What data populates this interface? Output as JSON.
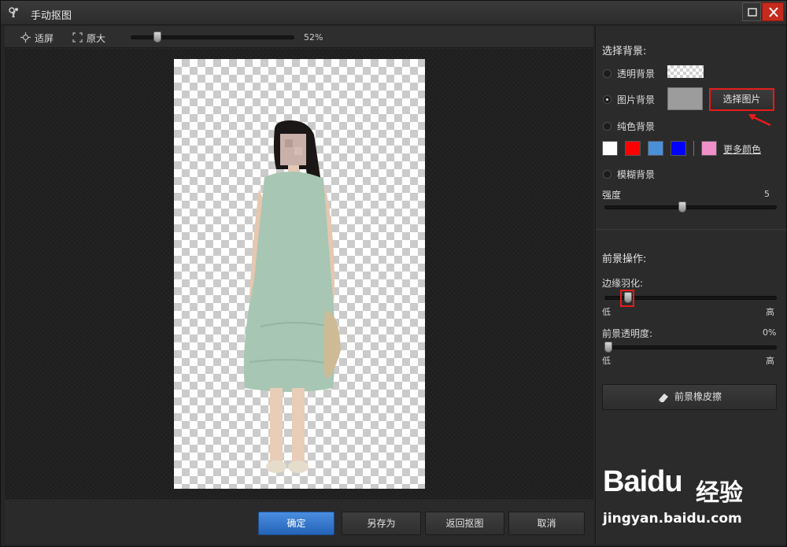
{
  "window": {
    "title": "手动抠图",
    "controls": {
      "maximize_icon": "maximize-icon",
      "close_icon": "close-icon"
    }
  },
  "toolbar": {
    "fit_screen_label": "适屏",
    "original_size_label": "原大",
    "zoom_value": "52%",
    "zoom_percent": 52
  },
  "footer": {
    "ok_label": "确定",
    "save_as_label": "另存为",
    "back_label": "返回抠图",
    "cancel_label": "取消"
  },
  "background_panel": {
    "title": "选择背景:",
    "options": {
      "transparent": "透明背景",
      "image": "图片背景",
      "solid": "纯色背景",
      "blur": "模糊背景"
    },
    "selected": "image",
    "choose_image_label": "选择图片",
    "colors": [
      "#ffffff",
      "#ff0000",
      "#4a90d9",
      "#0000ff",
      "#f090c8"
    ],
    "more_colors_label": "更多颜色",
    "strength_label": "强度",
    "strength_value": "5",
    "strength_fraction": 0.45
  },
  "foreground_panel": {
    "title": "前景操作:",
    "feather_label": "边缘羽化:",
    "feather_low": "低",
    "feather_high": "高",
    "feather_fraction": 0.12,
    "opacity_label": "前景透明度:",
    "opacity_value": "0%",
    "opacity_low": "低",
    "opacity_high": "高",
    "opacity_fraction": 0.0,
    "eraser_label": "前景橡皮擦"
  },
  "watermark": {
    "brand": "Baidu",
    "brand_cn": "经验",
    "url": "jingyan.baidu.com"
  }
}
